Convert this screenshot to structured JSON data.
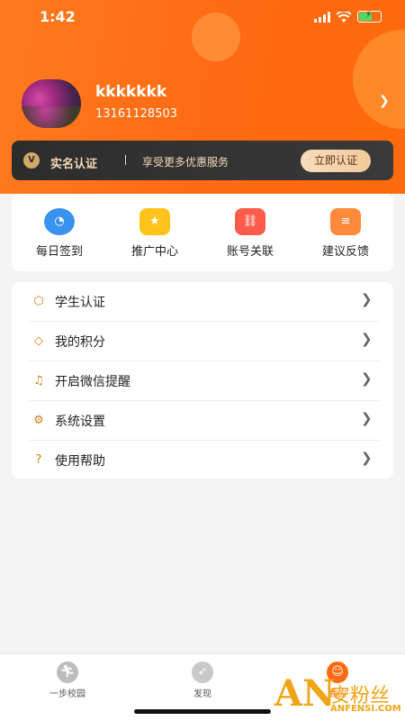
{
  "status_bar": {
    "time": "1:42"
  },
  "profile": {
    "username": "kkkkkkk",
    "phone": "13161128503"
  },
  "verify_banner": {
    "badge": "V",
    "title": "实名认证",
    "subtitle": "享受更多优惠服务",
    "button": "立即认证"
  },
  "quick_actions": [
    {
      "label": "每日签到",
      "icon": "calendar-checkin-icon",
      "color": "#3a92f0"
    },
    {
      "label": "推广中心",
      "icon": "star-gift-icon",
      "color": "#ffc41a"
    },
    {
      "label": "账号关联",
      "icon": "link-icon",
      "color": "#ff5b4d"
    },
    {
      "label": "建议反馈",
      "icon": "feedback-icon",
      "color": "#ff8a3a"
    }
  ],
  "menu": [
    {
      "label": "学生认证",
      "icon": "student-badge-icon"
    },
    {
      "label": "我的积分",
      "icon": "diamond-points-icon"
    },
    {
      "label": "开启微信提醒",
      "icon": "bell-icon"
    },
    {
      "label": "系统设置",
      "icon": "gear-icon"
    },
    {
      "label": "使用帮助",
      "icon": "help-icon"
    }
  ],
  "tabbar": [
    {
      "label": "一步校园",
      "icon": "runner-icon",
      "color": "#bdbdbd"
    },
    {
      "label": "发现",
      "icon": "compass-icon",
      "color": "#c9c9c9"
    },
    {
      "label": "我的",
      "icon": "profile-icon",
      "color": "#ff6a12"
    }
  ],
  "watermark": {
    "logo": "AN",
    "cn": "安粉丝",
    "en": "ANFENSI.COM"
  }
}
